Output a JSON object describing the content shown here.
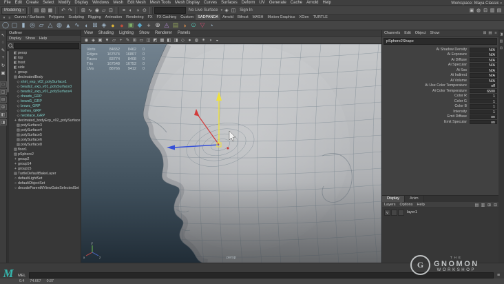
{
  "app": {
    "workspace_label": "Workspace:",
    "workspace_value": "Maya Classic"
  },
  "menubar": {
    "items": [
      "File",
      "Edit",
      "Create",
      "Select",
      "Modify",
      "Display",
      "Windows",
      "Mesh",
      "Edit Mesh",
      "Mesh Tools",
      "Mesh Display",
      "Curves",
      "Surfaces",
      "Deform",
      "UV",
      "Generate",
      "Cache",
      "Arnold",
      "Help"
    ]
  },
  "statusline": {
    "mode": "Modeling",
    "live_surface": "No Live Surface",
    "sign_in": "Sign In",
    "file_icons": [
      {
        "name": "new-scene-icon",
        "glyph": "▤"
      },
      {
        "name": "open-scene-icon",
        "glyph": "▧"
      },
      {
        "name": "save-scene-icon",
        "glyph": "▦"
      }
    ],
    "undo_icons": [
      {
        "name": "undo-icon",
        "glyph": "↶"
      },
      {
        "name": "redo-icon",
        "glyph": "↷"
      }
    ],
    "snap_icons": [
      {
        "name": "snap-grid-icon",
        "glyph": "⊞"
      },
      {
        "name": "snap-curve-icon",
        "glyph": "∿"
      },
      {
        "name": "snap-point-icon",
        "glyph": "◉"
      },
      {
        "name": "snap-plane-icon",
        "glyph": "▱"
      },
      {
        "name": "snap-view-icon",
        "glyph": "⊡"
      }
    ],
    "history_icons": [
      {
        "name": "construction-history-icon",
        "glyph": "≡"
      },
      {
        "name": "render-icon",
        "glyph": "◐"
      },
      {
        "name": "ipr-render-icon",
        "glyph": "◑"
      },
      {
        "name": "render-settings-icon",
        "glyph": "⊙"
      }
    ],
    "mid_icons": [
      {
        "name": "highlight-selection-icon",
        "glyph": "◈"
      },
      {
        "name": "symmetry-icon",
        "glyph": "◫"
      }
    ],
    "right_icons": [
      {
        "name": "modeling-toolkit-icon",
        "glyph": "▣"
      },
      {
        "name": "hypershade-icon",
        "glyph": "◍"
      },
      {
        "name": "tool-settings-icon",
        "glyph": "⊟"
      },
      {
        "name": "attribute-editor-icon",
        "glyph": "▥"
      },
      {
        "name": "channel-box-icon",
        "glyph": "▤"
      }
    ]
  },
  "shelf": {
    "tabs": [
      {
        "label": "Curves / Surfaces"
      },
      {
        "label": "Polygons"
      },
      {
        "label": "Sculpting"
      },
      {
        "label": "Rigging"
      },
      {
        "label": "Animation"
      },
      {
        "label": "Rendering"
      },
      {
        "label": "FX"
      },
      {
        "label": "FX Caching"
      },
      {
        "label": "Custom"
      },
      {
        "label": "SADPANDA",
        "cls": "active"
      },
      {
        "label": "Arnold"
      },
      {
        "label": "Bifrost"
      },
      {
        "label": "MASH"
      },
      {
        "label": "Motion Graphics"
      },
      {
        "label": "XGen"
      },
      {
        "label": "TURTLE"
      }
    ],
    "icons": [
      {
        "name": "poly-sphere-icon",
        "glyph": "◯",
        "color": "#9fb6c9"
      },
      {
        "name": "poly-cube-icon",
        "glyph": "▢",
        "color": "#9fb6c9"
      },
      {
        "name": "poly-cylinder-icon",
        "glyph": "▮",
        "color": "#9fb6c9"
      },
      {
        "name": "poly-torus-icon",
        "glyph": "◎",
        "color": "#9fb6c9"
      },
      {
        "name": "poly-plane-icon",
        "glyph": "▱",
        "color": "#9fb6c9"
      },
      {
        "name": "poly-cone-icon",
        "glyph": "△",
        "color": "#9fb6c9"
      },
      {
        "name": "poly-disc-icon",
        "glyph": "◍",
        "color": "#9fb6c9"
      },
      {
        "name": "poly-pyramid-icon",
        "glyph": "▲",
        "color": "#9fb6c9"
      },
      {
        "name": "poly-helix-icon",
        "glyph": "∿",
        "color": "#9fb6c9"
      },
      {
        "name": "poly-pipe-icon",
        "glyph": "◖",
        "color": "#9fb6c9"
      },
      {
        "name": "subdiv-icon",
        "glyph": "⊞",
        "color": "#9fb6c9"
      },
      {
        "name": "platonic-solid-icon",
        "glyph": "◈",
        "color": "#9fb6c9"
      },
      {
        "name": "sculpt-tool-icon",
        "glyph": "●",
        "color": "#d8b13a"
      },
      {
        "name": "smooth-tool-icon",
        "glyph": "●",
        "color": "#c04f3d"
      },
      {
        "name": "quad-draw-icon",
        "glyph": "▣",
        "color": "#7fb069"
      },
      {
        "name": "multi-cut-icon",
        "glyph": "◆",
        "color": "#5aa7c7"
      },
      {
        "name": "target-weld-icon",
        "glyph": "+",
        "color": "#c9c9c9"
      },
      {
        "name": "merge-icon",
        "glyph": "⊕",
        "color": "#c9c9c9"
      },
      {
        "name": "mirror-icon",
        "glyph": "◬",
        "color": "#b08ad0"
      },
      {
        "name": "uv-editor-icon",
        "glyph": "▤",
        "color": "#8fa05a"
      },
      {
        "name": "bevel-icon",
        "glyph": "◑",
        "color": "#d0884a"
      },
      {
        "name": "arnold-render-icon",
        "glyph": "⊙",
        "color": "#52b8a8"
      },
      {
        "name": "extrude-icon",
        "glyph": "▽",
        "color": "#d04a6e"
      },
      {
        "name": "bridge-icon",
        "glyph": "◔",
        "color": "#9fb6c9"
      }
    ]
  },
  "toolbox": {
    "tools": [
      {
        "name": "select-tool-icon",
        "glyph": "↖"
      },
      {
        "name": "lasso-tool-icon",
        "glyph": "◌"
      },
      {
        "name": "paint-select-tool-icon",
        "glyph": "✎"
      },
      {
        "name": "move-tool-icon",
        "glyph": "+"
      },
      {
        "name": "rotate-tool-icon",
        "glyph": "↻"
      },
      {
        "name": "scale-tool-icon",
        "glyph": "▣"
      }
    ],
    "layouts": [
      {
        "name": "layout-single-pane-icon",
        "glyph": "□"
      },
      {
        "name": "layout-two-side-icon",
        "glyph": "◫"
      },
      {
        "name": "layout-two-stack-icon",
        "glyph": "⊟"
      },
      {
        "name": "layout-four-pane-icon",
        "glyph": "⊞"
      },
      {
        "name": "layout-outliner-persp-icon",
        "glyph": "◧"
      },
      {
        "name": "layout-hypershade-persp-icon",
        "glyph": "◨"
      }
    ]
  },
  "outliner": {
    "title": "Outliner",
    "menus": [
      "Display",
      "Show",
      "Help"
    ],
    "search_placeholder": "",
    "items": [
      {
        "icon": "◧",
        "iname": "camera-icon",
        "name": "persp",
        "ind": "5px"
      },
      {
        "icon": "◧",
        "iname": "camera-icon",
        "name": "top",
        "ind": "5px"
      },
      {
        "icon": "◧",
        "iname": "camera-icon",
        "name": "front",
        "ind": "5px"
      },
      {
        "icon": "◧",
        "iname": "camera-icon",
        "name": "side",
        "ind": "5px"
      },
      {
        "icon": "+",
        "iname": "transform-icon",
        "name": "group",
        "ind": "5px"
      },
      {
        "icon": "▧",
        "iname": "mesh-icon",
        "name": "decimatedBody",
        "ind": "5px"
      },
      {
        "icon": "◇",
        "iname": "reference-mesh-icon",
        "name": "shirt_exp_v02_polySurface1",
        "cls": "ref",
        "ind": "9px"
      },
      {
        "icon": "◇",
        "iname": "reference-mesh-icon",
        "name": "beads2_exp_v01_polySurface3",
        "cls": "ref",
        "ind": "9px"
      },
      {
        "icon": "◇",
        "iname": "reference-mesh-icon",
        "name": "beads2_exp_v01_polySurface4",
        "cls": "ref",
        "ind": "9px"
      },
      {
        "icon": "◇",
        "iname": "reference-mesh-icon",
        "name": "dreads_GRP",
        "cls": "ref",
        "ind": "9px"
      },
      {
        "icon": "◇",
        "iname": "reference-mesh-icon",
        "name": "beard1_GRP",
        "cls": "ref",
        "ind": "9px"
      },
      {
        "icon": "◇",
        "iname": "reference-mesh-icon",
        "name": "brows_GRP",
        "cls": "ref",
        "ind": "9px"
      },
      {
        "icon": "◇",
        "iname": "reference-mesh-icon",
        "name": "lashes_GRP",
        "cls": "ref",
        "ind": "9px"
      },
      {
        "icon": "◇",
        "iname": "reference-mesh-icon",
        "name": "necklace_GRP",
        "cls": "ref",
        "ind": "9px"
      },
      {
        "icon": "+",
        "iname": "transform-icon",
        "name": "decimated_bodyExp_v02_polySurface",
        "ind": "5px"
      },
      {
        "icon": "▧",
        "iname": "mesh-icon",
        "name": "polySurface3",
        "ind": "9px"
      },
      {
        "icon": "▧",
        "iname": "mesh-icon",
        "name": "polySurface4",
        "ind": "9px"
      },
      {
        "icon": "▧",
        "iname": "mesh-icon",
        "name": "polySurface5",
        "ind": "9px"
      },
      {
        "icon": "▧",
        "iname": "mesh-icon",
        "name": "polySurface6",
        "ind": "9px"
      },
      {
        "icon": "▧",
        "iname": "mesh-icon",
        "name": "polySurface8",
        "ind": "9px"
      },
      {
        "icon": "▧",
        "iname": "mesh-icon",
        "name": "floor1",
        "ind": "5px"
      },
      {
        "icon": "▧",
        "iname": "mesh-icon",
        "name": "pSphere2",
        "ind": "5px"
      },
      {
        "icon": "+",
        "iname": "transform-icon",
        "name": "group2",
        "ind": "5px"
      },
      {
        "icon": "+",
        "iname": "transform-icon",
        "name": "group14",
        "ind": "5px"
      },
      {
        "icon": "+",
        "iname": "transform-icon",
        "name": "group15",
        "ind": "5px"
      },
      {
        "icon": "▤",
        "iname": "bake-layer-icon",
        "name": "TurtleDefaultBakeLayer",
        "ind": "5px"
      },
      {
        "icon": "○",
        "iname": "set-icon",
        "name": "defaultLightSet",
        "ind": "5px"
      },
      {
        "icon": "○",
        "iname": "set-icon",
        "name": "defaultObjectSet",
        "ind": "5px"
      },
      {
        "icon": "○",
        "iname": "set-icon",
        "name": "decodeParentMViewGateSelectedSet",
        "ind": "5px"
      }
    ]
  },
  "viewport": {
    "menus": [
      "View",
      "Shading",
      "Lighting",
      "Show",
      "Renderer",
      "Panels"
    ],
    "toolbar_icons": [
      {
        "name": "select-camera-icon",
        "glyph": "◉"
      },
      {
        "name": "lock-camera-icon",
        "glyph": "◈"
      },
      {
        "name": "camera-attributes-icon",
        "glyph": "▣"
      },
      {
        "name": "bookmark-icon",
        "glyph": "▼"
      },
      {
        "name": "image-plane-icon",
        "glyph": "▱"
      },
      {
        "name": "two-d-pan-zoom-icon",
        "glyph": "+"
      },
      {
        "name": "grease-pencil-icon",
        "glyph": "✎"
      },
      {
        "name": "grid-icon",
        "glyph": "⊞"
      },
      {
        "name": "film-gate-icon",
        "glyph": "▭"
      },
      {
        "name": "resolution-gate-icon",
        "glyph": "◫"
      },
      {
        "name": "gate-mask-icon",
        "glyph": "◩"
      },
      {
        "name": "field-chart-icon",
        "glyph": "▦"
      },
      {
        "name": "safe-action-icon",
        "glyph": "◧"
      },
      {
        "name": "safe-title-icon",
        "glyph": "◨"
      },
      {
        "name": "wireframe-icon",
        "glyph": "◇"
      },
      {
        "name": "shaded-icon",
        "glyph": "●"
      },
      {
        "name": "textured-icon",
        "glyph": "◍"
      },
      {
        "name": "lights-icon",
        "glyph": "☀"
      },
      {
        "name": "shadows-icon",
        "glyph": "◑"
      },
      {
        "name": "xray-icon",
        "glyph": "◒"
      }
    ],
    "hud": {
      "rows": [
        {
          "label": "Verts",
          "total": "84652",
          "selected": "8462",
          "comp": "0"
        },
        {
          "label": "Edges",
          "total": "167574",
          "selected": "16807",
          "comp": "0"
        },
        {
          "label": "Faces",
          "total": "83774",
          "selected": "8408",
          "comp": "0"
        },
        {
          "label": "Tris",
          "total": "167548",
          "selected": "16752",
          "comp": "0"
        },
        {
          "label": "UVs",
          "total": "88766",
          "selected": "9412",
          "comp": "0"
        }
      ]
    },
    "camera_label": "persp",
    "axis_labels": {
      "x": "x",
      "y": "y",
      "z": "z"
    }
  },
  "channelbox": {
    "menus": [
      "Channels",
      "Edit",
      "Object",
      "Show"
    ],
    "mini_icons": [
      {
        "name": "channel-manipulator-icon",
        "glyph": "⊞"
      },
      {
        "name": "channel-speed-icon",
        "glyph": "▤"
      },
      {
        "name": "channel-hyperbolic-icon",
        "glyph": "≡"
      }
    ],
    "object_name": "pSphere2Shape",
    "rows": [
      {
        "label": "Ai Shadow Density",
        "value": "N/A"
      },
      {
        "label": "Ai Exposure",
        "value": "N/A"
      },
      {
        "label": "Ai Diffuse",
        "value": "N/A"
      },
      {
        "label": "Ai Specular",
        "value": "N/A"
      },
      {
        "label": "Ai Sss",
        "value": "N/A"
      },
      {
        "label": "Ai Indirect",
        "value": "N/A"
      },
      {
        "label": "Ai Volume",
        "value": "N/A"
      },
      {
        "label": "Ai Use Color Temperature",
        "value": "off"
      },
      {
        "label": "Ai Color Temperature",
        "value": "6500"
      },
      {
        "label": "Color R",
        "value": "1"
      },
      {
        "label": "Color G",
        "value": "1"
      },
      {
        "label": "Color B",
        "value": "1"
      },
      {
        "label": "Intensity",
        "value": "1"
      },
      {
        "label": "Emit Diffuse",
        "value": "on"
      },
      {
        "label": "Emit Specular",
        "value": "on"
      }
    ]
  },
  "layers": {
    "tabs": [
      {
        "label": "Display",
        "cls": "active"
      },
      {
        "label": "Anim"
      }
    ],
    "menus": [
      "Layers",
      "Options",
      "Help"
    ],
    "icons": [
      {
        "name": "move-layer-up-icon",
        "glyph": "▤"
      },
      {
        "name": "empty-layer-icon",
        "glyph": "▥"
      },
      {
        "name": "new-layer-icon",
        "glyph": "⊞"
      },
      {
        "name": "new-layer-selected-icon",
        "glyph": "⊟"
      }
    ],
    "rows": [
      {
        "t1": "V",
        "t2": "",
        "t3": "",
        "name": "layer1"
      }
    ]
  },
  "rightstrip": {
    "icons": [
      {
        "name": "channel-box-toggle-icon",
        "glyph": "◨"
      },
      {
        "name": "attribute-editor-toggle-icon",
        "glyph": "▥"
      },
      {
        "name": "tool-settings-toggle-icon",
        "glyph": "⊟"
      }
    ]
  },
  "command_line": {
    "label": "MEL",
    "value": ""
  },
  "helpline": {
    "values": [
      "0.4",
      "74.667",
      "0.87"
    ]
  },
  "watermark": {
    "line1": "THE",
    "line2": "GNOMON",
    "line3": "WORKSHOP"
  },
  "maya_logo_letter": "M",
  "colors": {
    "viewport_top": "#72828f",
    "viewport_bottom": "#202c36",
    "axis_x": "#d23b3b",
    "axis_y_active": "#f0e23a",
    "axis_z": "#3550d8",
    "reference_text": "#7fd1cb",
    "maya_teal": "#35b5ac"
  }
}
